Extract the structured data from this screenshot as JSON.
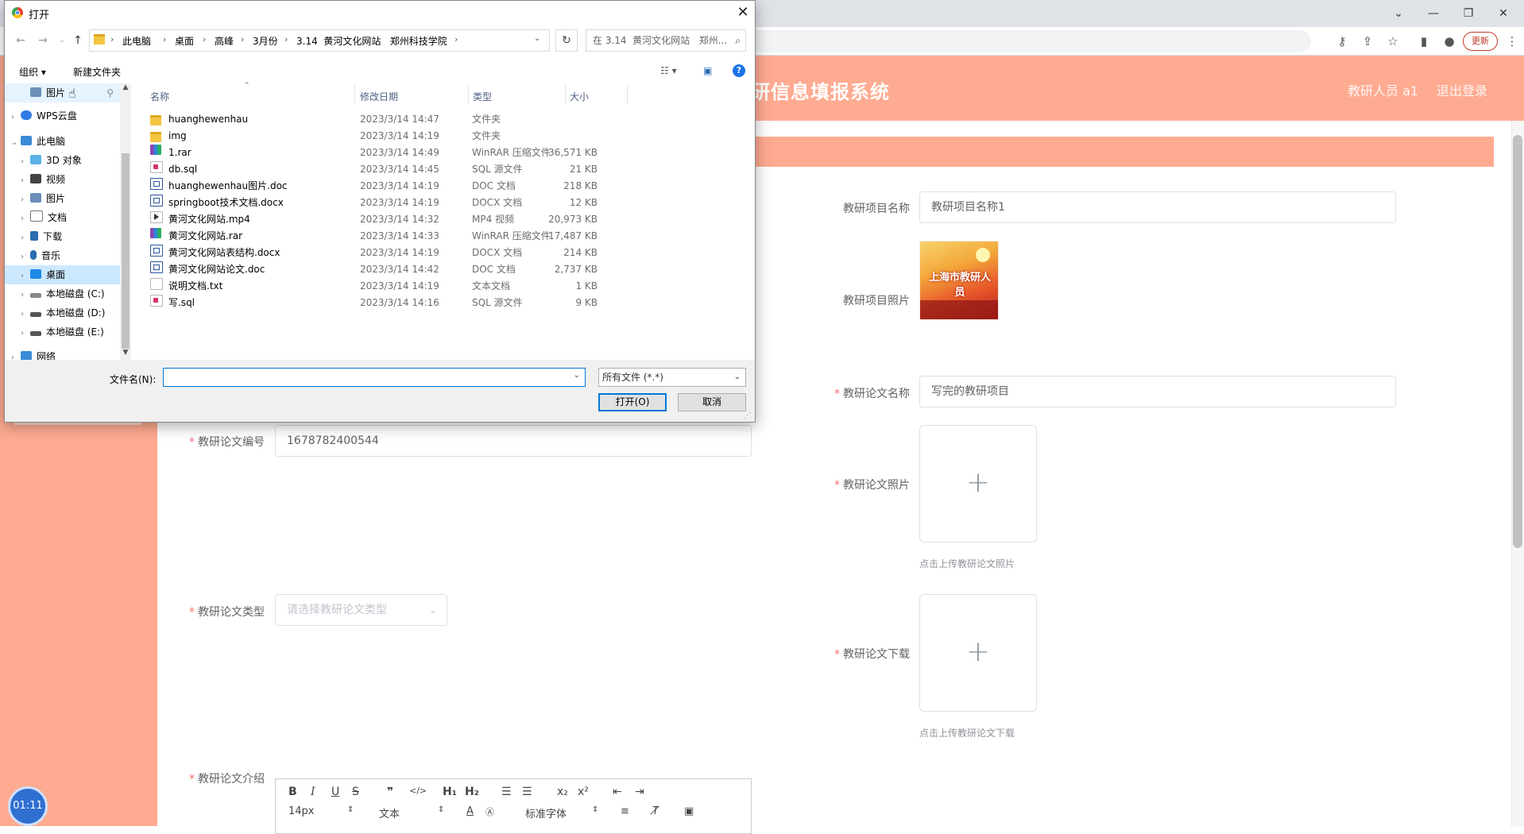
{
  "browser": {
    "update_label": "更新"
  },
  "app": {
    "title": "研信息填报系统",
    "user_label": "教研人员 a1",
    "logout_label": "退出登录"
  },
  "form": {
    "project_name_label": "教研项目名称",
    "project_name_value": "教研项目名称1",
    "project_photo_label": "教研项目照片",
    "project_photo_text": "上海市教研人员",
    "paper_name_label": "教研论文名称",
    "paper_name_value": "写完的教研项目",
    "paper_photo_label": "教研论文照片",
    "paper_photo_hint": "点击上传教研论文照片",
    "paper_no_label": "教研论文编号",
    "paper_no_value": "1678782400544",
    "paper_type_label": "教研论文类型",
    "paper_type_placeholder": "请选择教研论文类型",
    "paper_download_label": "教研论文下载",
    "paper_download_hint": "点击上传教研论文下载",
    "paper_intro_label": "教研论文介绍",
    "required_mark": "*",
    "upload_plus": "+"
  },
  "editor": {
    "font_size": "14px",
    "text_style": "文本",
    "font_family": "标准字体"
  },
  "timer": "01:11",
  "dialog": {
    "title": "打开",
    "breadcrumbs": [
      "此电脑",
      "桌面",
      "高峰",
      "3月份",
      "3.14  黄河文化网站   郑州科技学院"
    ],
    "search_placeholder": "在 3.14  黄河文化网站   郑州...",
    "organize_label": "组织 ▾",
    "new_folder_label": "新建文件夹",
    "nav_items": [
      {
        "label": "图片",
        "type": "quick"
      },
      {
        "label": "WPS云盘",
        "type": "cloud"
      },
      {
        "label": "此电脑",
        "type": "pc"
      },
      {
        "label": "3D 对象",
        "type": "item"
      },
      {
        "label": "视频",
        "type": "item"
      },
      {
        "label": "图片",
        "type": "item"
      },
      {
        "label": "文档",
        "type": "item"
      },
      {
        "label": "下载",
        "type": "item"
      },
      {
        "label": "音乐",
        "type": "item"
      },
      {
        "label": "桌面",
        "type": "item"
      },
      {
        "label": "本地磁盘 (C:)",
        "type": "drive"
      },
      {
        "label": "本地磁盘 (D:)",
        "type": "drive"
      },
      {
        "label": "本地磁盘 (E:)",
        "type": "drive"
      },
      {
        "label": "网络",
        "type": "net"
      }
    ],
    "columns": {
      "name": "名称",
      "date": "修改日期",
      "type": "类型",
      "size": "大小"
    },
    "files": [
      {
        "name": "huanghewenhau",
        "date": "2023/3/14 14:47",
        "type": "文件夹",
        "size": "",
        "icon": "folder"
      },
      {
        "name": "img",
        "date": "2023/3/14 14:19",
        "type": "文件夹",
        "size": "",
        "icon": "folder"
      },
      {
        "name": "1.rar",
        "date": "2023/3/14 14:49",
        "type": "WinRAR 压缩文件",
        "size": "36,571 KB",
        "icon": "rar"
      },
      {
        "name": "db.sql",
        "date": "2023/3/14 14:45",
        "type": "SQL 源文件",
        "size": "21 KB",
        "icon": "sql"
      },
      {
        "name": "huanghewenhau图片.doc",
        "date": "2023/3/14 14:19",
        "type": "DOC 文档",
        "size": "218 KB",
        "icon": "doc"
      },
      {
        "name": "springboot技术文档.docx",
        "date": "2023/3/14 14:19",
        "type": "DOCX 文档",
        "size": "12 KB",
        "icon": "doc"
      },
      {
        "name": "黄河文化网站.mp4",
        "date": "2023/3/14 14:32",
        "type": "MP4 视频",
        "size": "20,973 KB",
        "icon": "mp4"
      },
      {
        "name": "黄河文化网站.rar",
        "date": "2023/3/14 14:33",
        "type": "WinRAR 压缩文件",
        "size": "17,487 KB",
        "icon": "rar"
      },
      {
        "name": "黄河文化网站表结构.docx",
        "date": "2023/3/14 14:19",
        "type": "DOCX 文档",
        "size": "214 KB",
        "icon": "doc"
      },
      {
        "name": "黄河文化网站论文.doc",
        "date": "2023/3/14 14:42",
        "type": "DOC 文档",
        "size": "2,737 KB",
        "icon": "doc"
      },
      {
        "name": "说明文档.txt",
        "date": "2023/3/14 14:19",
        "type": "文本文档",
        "size": "1 KB",
        "icon": "txt"
      },
      {
        "name": "写.sql",
        "date": "2023/3/14 14:16",
        "type": "SQL 源文件",
        "size": "9 KB",
        "icon": "sql"
      }
    ],
    "filename_label": "文件名(N):",
    "filename_value": "",
    "filetype_value": "所有文件 (*.*)",
    "open_label": "打开(O)",
    "cancel_label": "取消"
  }
}
